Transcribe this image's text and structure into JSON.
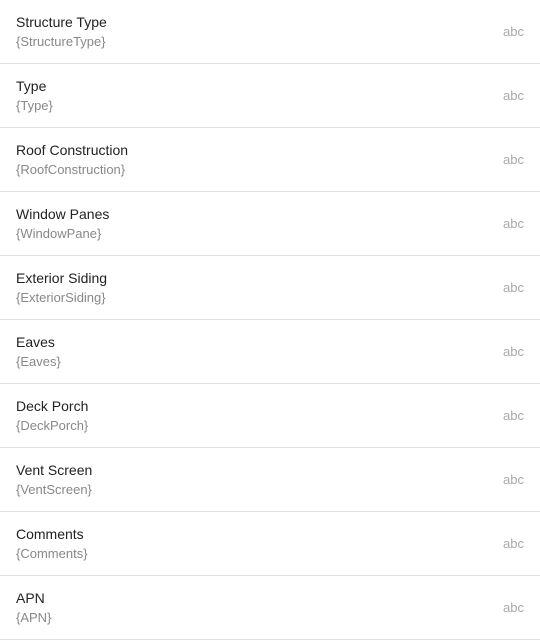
{
  "items": [
    {
      "id": "structure-type",
      "label": "Structure Type",
      "value": "{StructureType}",
      "type": "abc"
    },
    {
      "id": "type",
      "label": "Type",
      "value": "{Type}",
      "type": "abc"
    },
    {
      "id": "roof-construction",
      "label": "Roof Construction",
      "value": "{RoofConstruction}",
      "type": "abc"
    },
    {
      "id": "window-panes",
      "label": "Window Panes",
      "value": "{WindowPane}",
      "type": "abc"
    },
    {
      "id": "exterior-siding",
      "label": "Exterior Siding",
      "value": "{ExteriorSiding}",
      "type": "abc"
    },
    {
      "id": "eaves",
      "label": "Eaves",
      "value": "{Eaves}",
      "type": "abc"
    },
    {
      "id": "deck-porch",
      "label": "Deck Porch",
      "value": "{DeckPorch}",
      "type": "abc"
    },
    {
      "id": "vent-screen",
      "label": "Vent Screen",
      "value": "{VentScreen}",
      "type": "abc"
    },
    {
      "id": "comments",
      "label": "Comments",
      "value": "{Comments}",
      "type": "abc"
    },
    {
      "id": "apn",
      "label": "APN",
      "value": "{APN}",
      "type": "abc"
    }
  ]
}
